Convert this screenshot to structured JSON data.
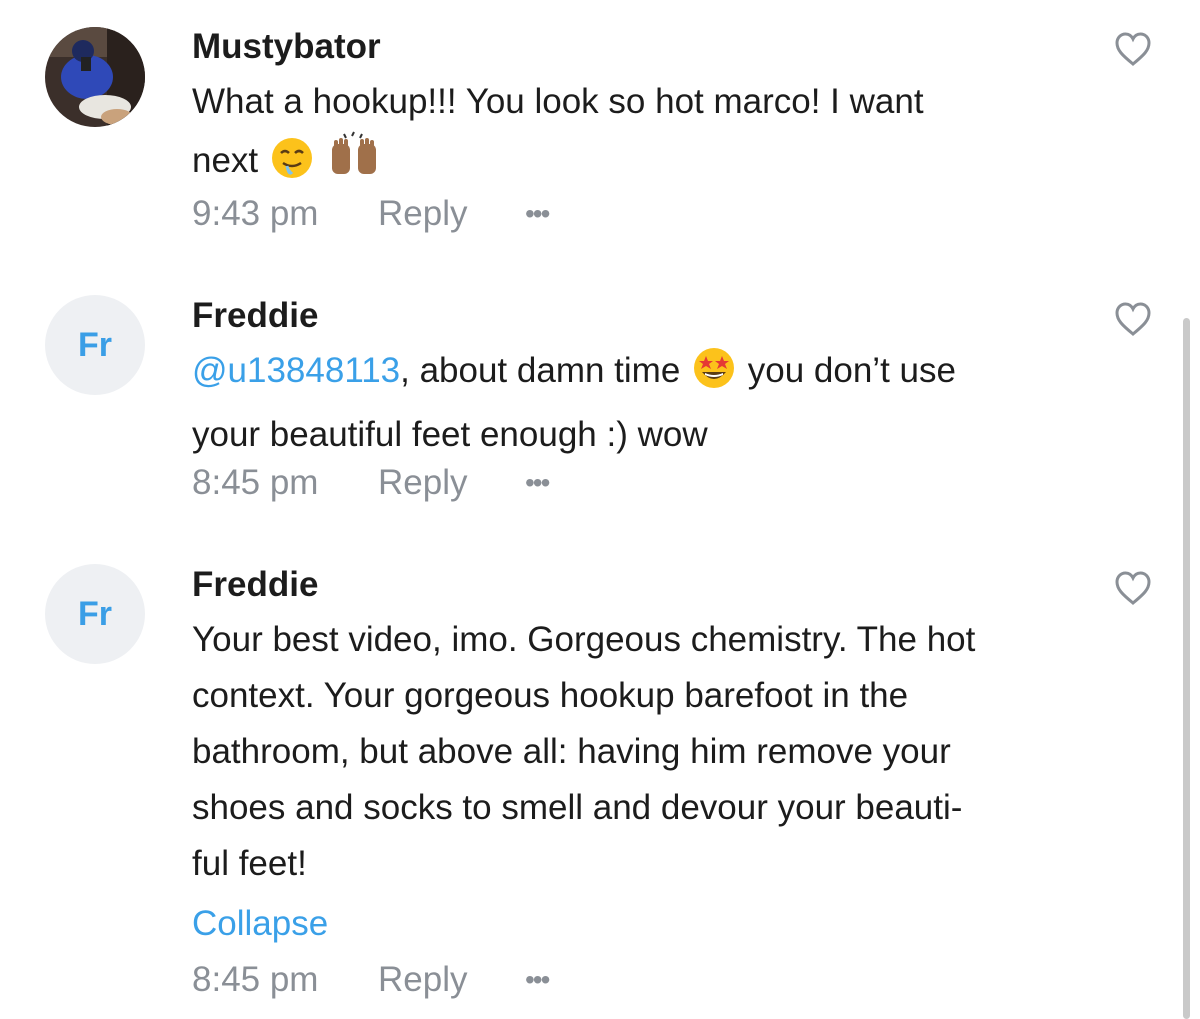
{
  "comments": [
    {
      "username": "Mustybator",
      "avatar": "profile-photo",
      "lines": [
        "What a hookup!!! You look so hot marco! I want",
        "next"
      ],
      "emojis": [
        "drooling-face-emoji",
        "raising-hands-emoji"
      ],
      "time": "9:43 pm",
      "reply_label": "Reply",
      "more_label": "•••"
    },
    {
      "username": "Freddie",
      "avatar_initials": "Fr",
      "mention": "@u13848113",
      "line1_after_mention": ", about damn time",
      "line1_after_emoji": " you don’t use",
      "emojis": [
        "star-struck-emoji"
      ],
      "line2": "your beautiful feet enough :) wow",
      "time": "8:45 pm",
      "reply_label": "Reply",
      "more_label": "•••"
    },
    {
      "username": "Freddie",
      "avatar_initials": "Fr",
      "lines": [
        "Your best video, imo. Gorgeous chemistry. The hot",
        "context. Your gorgeous hookup barefoot in the",
        "bathroom, but above all: having him remove your",
        "shoes and socks to smell and devour your beauti-",
        "ful feet!"
      ],
      "collapse_label": "Collapse",
      "time": "8:45 pm",
      "reply_label": "Reply",
      "more_label": "•••"
    }
  ],
  "icons": {
    "like": "heart-outline-icon",
    "more": "more-dots-icon"
  },
  "colors": {
    "text": "#1c1c1c",
    "muted": "#8a8f96",
    "link": "#3aa0e8",
    "avatar_bg": "#eef0f3"
  }
}
